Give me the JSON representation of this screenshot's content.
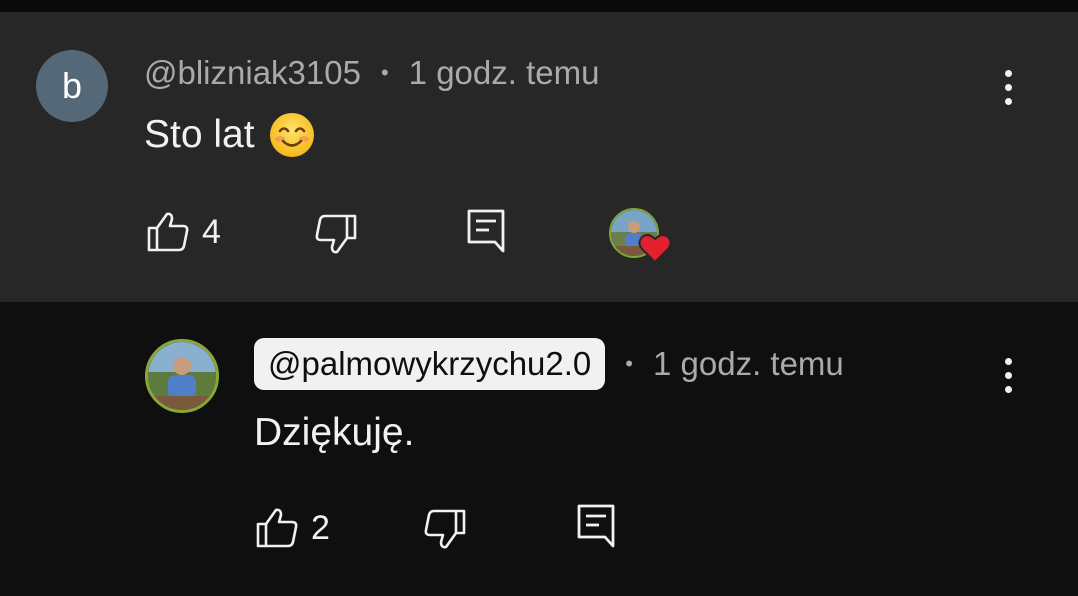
{
  "comment": {
    "avatar_letter": "b",
    "author": "@blizniak3105",
    "separator": "•",
    "time": "1 godz. temu",
    "text": "Sto lat",
    "emoji_icon": "smiling-face-emoji",
    "likes": "4",
    "creator_heart": true,
    "heart_color": "#e5202e"
  },
  "reply": {
    "author": "@palmowykrzychu2.0",
    "separator": "•",
    "time": "1 godz. temu",
    "text": "Dziękuję.",
    "likes": "2"
  },
  "colors": {
    "comment_bg": "#272727",
    "reply_bg": "#0f0f0f",
    "avatar_letter_bg": "#546877",
    "secondary_text": "#aaaaaa",
    "primary_text": "#f1f1f1"
  }
}
